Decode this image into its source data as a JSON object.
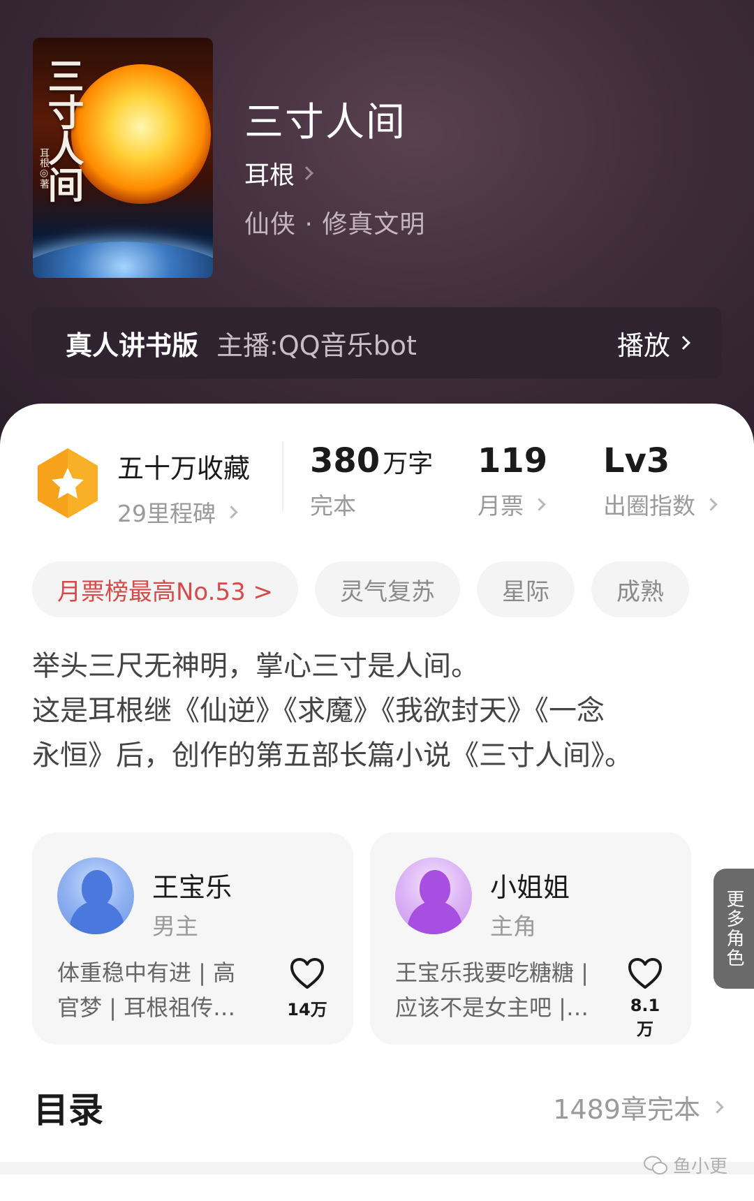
{
  "book": {
    "cover_title": "三寸人间",
    "cover_author": "耳根◎著",
    "title": "三寸人间",
    "author": "耳根",
    "genre": "仙侠 · 修真文明"
  },
  "audio": {
    "label": "真人讲书版",
    "host": "主播:QQ音乐bot",
    "play": "播放"
  },
  "stats": {
    "collect_main": "五十万收藏",
    "collect_sub": "29里程碑",
    "words_num": "380",
    "words_unit": "万字",
    "words_label": "完本",
    "tickets_num": "119",
    "tickets_label": "月票",
    "index_num": "Lv3",
    "index_label": "出圈指数"
  },
  "tags": [
    "月票榜最高No.53 >",
    "灵气复苏",
    "星际",
    "成熟"
  ],
  "description": [
    "举头三尺无神明，掌心三寸是人间。",
    "这是耳根继《仙逆》《求魔》《我欲封天》《一念",
    "永恒》后，创作的第五部长篇小说《三寸人间》。"
  ],
  "characters": [
    {
      "name": "王宝乐",
      "role": "男主",
      "tags_line1": "体重稳中有进 | 高",
      "tags_line2": "官梦 | 耳根祖传…",
      "likes": "14万"
    },
    {
      "name": "小姐姐",
      "role": "主角",
      "tags_line1": "王宝乐我要吃糖糖 |",
      "tags_line2": "应该不是女主吧 |…",
      "likes": "8.1万"
    }
  ],
  "more_roles": "更多角色",
  "toc": {
    "title": "目录",
    "info": "1489章完本"
  },
  "watermark": "鱼小更",
  "colors": {
    "hero_bg": "#3f2c3a",
    "rank_red": "#d64a4a",
    "badge_orange": "#f6a21a"
  }
}
